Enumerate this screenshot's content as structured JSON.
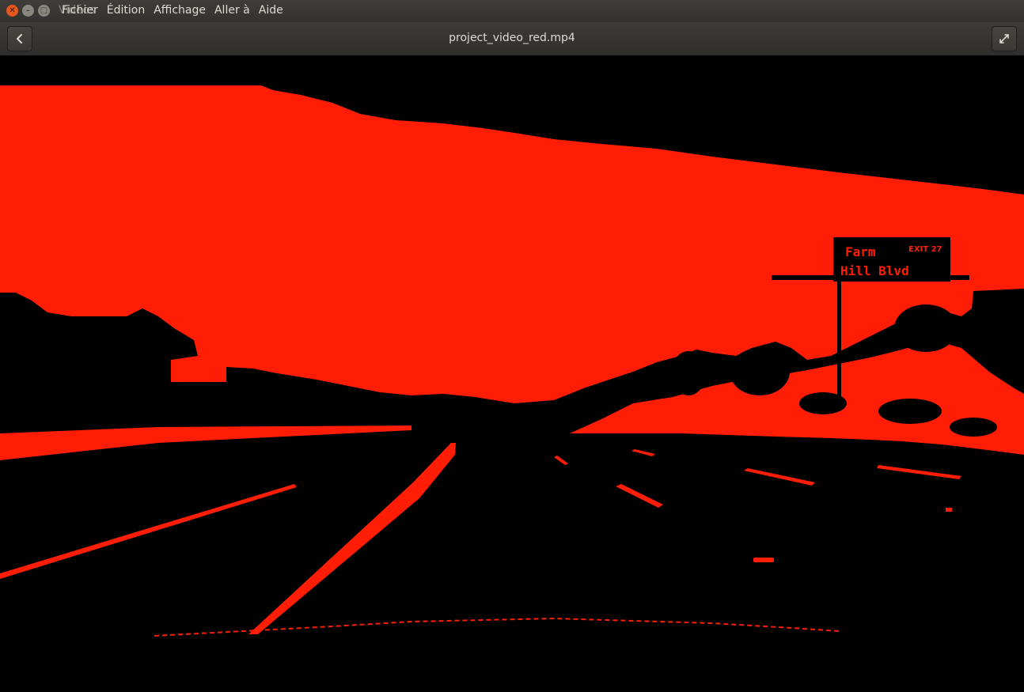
{
  "window": {
    "app_name": "Vidéos",
    "menus": [
      "Fichier",
      "Édition",
      "Affichage",
      "Aller à",
      "Aide"
    ]
  },
  "header": {
    "title": "project_video_red.mp4",
    "back_icon": "chevron-left-icon",
    "fullscreen_icon": "fullscreen-icon"
  },
  "frame": {
    "sign": {
      "line1": "Farm",
      "exit": "EXIT 27",
      "line2": "Hill Blvd"
    },
    "colors": {
      "mask": "#ff1e05",
      "background": "#000000"
    }
  }
}
